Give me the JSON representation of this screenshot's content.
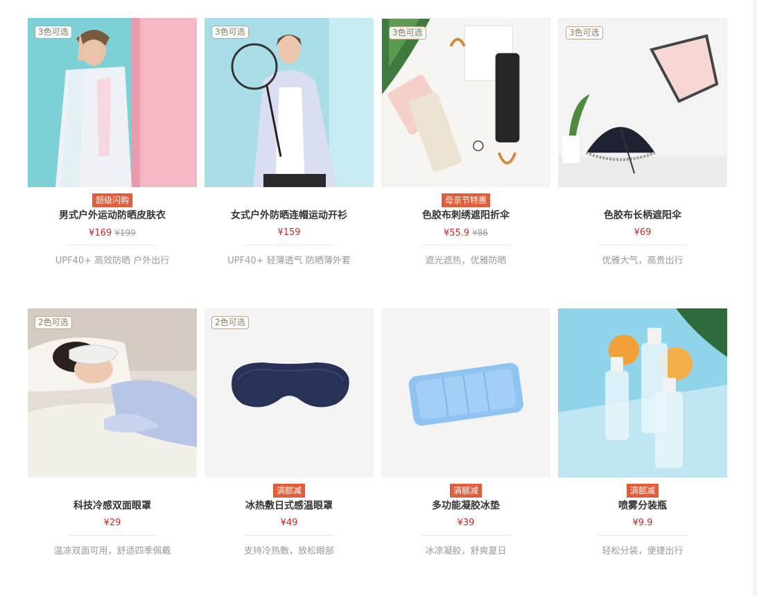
{
  "products": [
    {
      "color_badge": "3色可选",
      "tag": "超级闪购",
      "name": "男式户外运动防晒皮肤衣",
      "price": "¥169",
      "old_price": "¥199",
      "desc": "UPF40+ 高效防晒 户外出行"
    },
    {
      "color_badge": "3色可选",
      "tag": "",
      "name": "女式户外防晒连帽运动开衫",
      "price": "¥159",
      "old_price": "",
      "desc": "UPF40+ 轻薄透气 防晒薄外套"
    },
    {
      "color_badge": "3色可选",
      "tag": "母亲节特惠",
      "name": "色胶布刺绣遮阳折伞",
      "price": "¥55.9",
      "old_price": "¥86",
      "desc": "遮光遮热，优雅防晒"
    },
    {
      "color_badge": "3色可选",
      "tag": "",
      "name": "色胶布长柄遮阳伞",
      "price": "¥69",
      "old_price": "",
      "desc": "优雅大气，高贵出行"
    },
    {
      "color_badge": "2色可选",
      "tag": "",
      "name": "科技冷感双面眼罩",
      "price": "¥29",
      "old_price": "",
      "desc": "温凉双面可用，舒适四季佩戴"
    },
    {
      "color_badge": "2色可选",
      "tag": "满额减",
      "name": "冰热敷日式感温眼罩",
      "price": "¥49",
      "old_price": "",
      "desc": "支持冷热敷，放松眼部"
    },
    {
      "color_badge": "",
      "tag": "满额减",
      "name": "多功能凝胶冰垫",
      "price": "¥39",
      "old_price": "",
      "desc": "冰凉凝胶，舒爽夏日"
    },
    {
      "color_badge": "",
      "tag": "满额减",
      "name": "喷雾分装瓶",
      "price": "¥9.9",
      "old_price": "",
      "desc": "轻松分装，便捷出行"
    }
  ],
  "image_names": [
    "man-sun-jacket-photo",
    "woman-hooded-jacket-photo",
    "folding-umbrellas-photo",
    "long-umbrella-photo",
    "sleeping-eye-mask-photo",
    "navy-eye-mask-photo",
    "blue-gel-pad-photo",
    "spray-bottles-photo"
  ],
  "colors": {
    "tag_bg": "#e05e3b",
    "price": "#c8282a",
    "badge_border": "#b8a68e"
  }
}
